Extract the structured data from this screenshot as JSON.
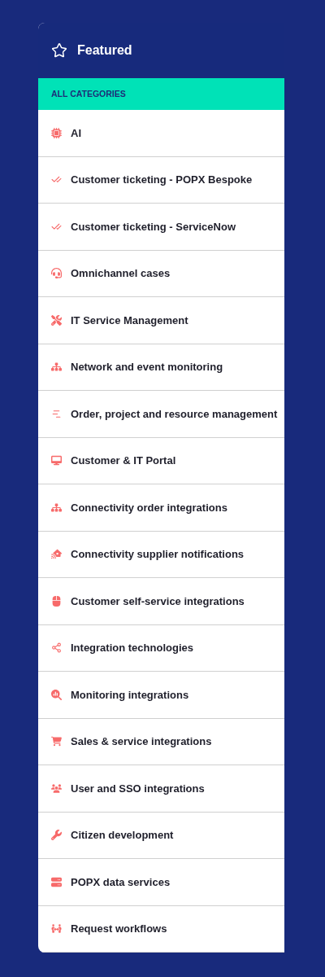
{
  "header": {
    "title": "Featured"
  },
  "section": {
    "label": "ALL CATEGORIES"
  },
  "categories": [
    {
      "label": "AI"
    },
    {
      "label": "Customer ticketing - POPX Bespoke"
    },
    {
      "label": "Customer ticketing - ServiceNow"
    },
    {
      "label": "Omnichannel cases"
    },
    {
      "label": "IT Service Management"
    },
    {
      "label": "Network and event monitoring"
    },
    {
      "label": "Order, project and resource management"
    },
    {
      "label": "Customer & IT Portal"
    },
    {
      "label": "Connectivity order integrations"
    },
    {
      "label": "Connectivity supplier notifications"
    },
    {
      "label": "Customer self-service integrations"
    },
    {
      "label": "Integration technologies"
    },
    {
      "label": "Monitoring integrations"
    },
    {
      "label": "Sales & service integrations"
    },
    {
      "label": "User and SSO integrations"
    },
    {
      "label": "Citizen development"
    },
    {
      "label": "POPX data services"
    },
    {
      "label": "Request workflows"
    }
  ]
}
